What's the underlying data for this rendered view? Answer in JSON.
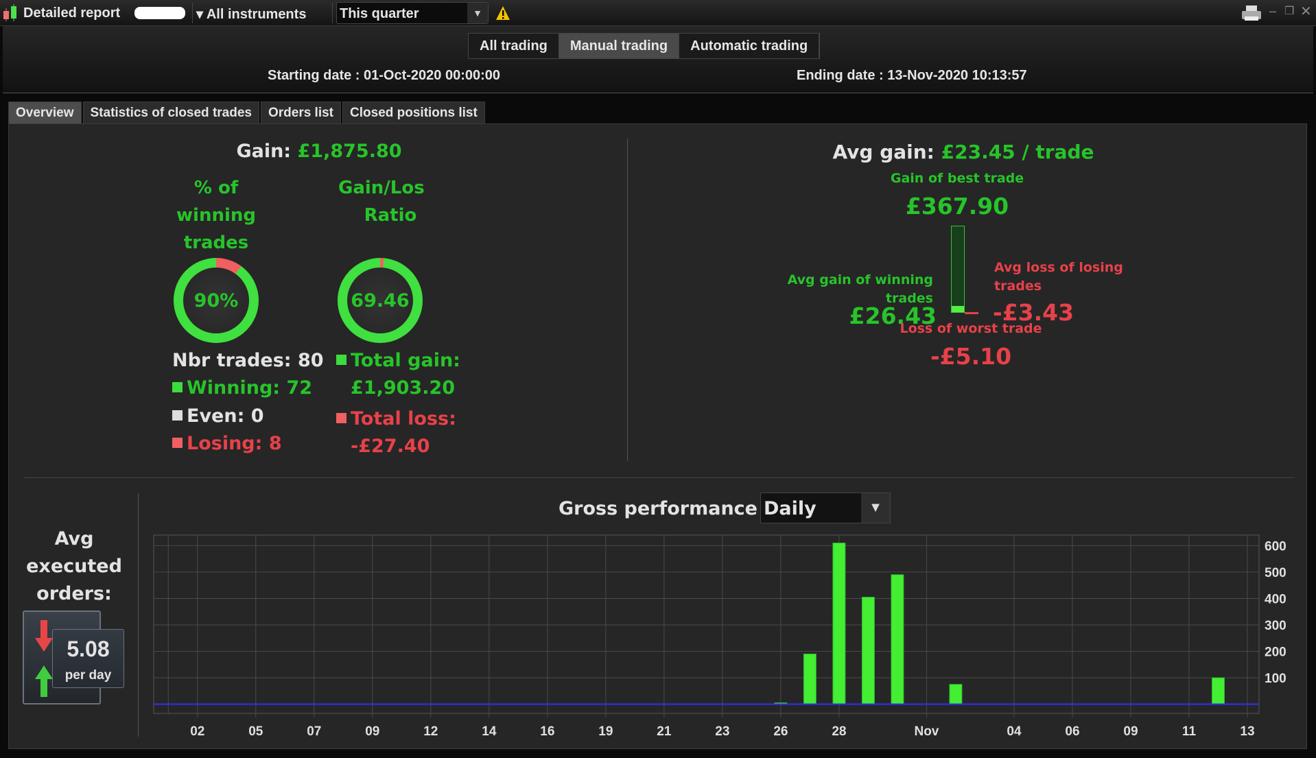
{
  "topbar": {
    "title": "Detailed report",
    "instruments": "All instruments",
    "period": "This quarter",
    "icons": [
      "candlestick-icon",
      "warning-icon",
      "print-icon",
      "minimize-icon",
      "restore-icon",
      "close-icon"
    ]
  },
  "trading_tabs": [
    "All trading",
    "Manual trading",
    "Automatic trading"
  ],
  "dates": {
    "start": "Starting date : 01-Oct-2020 00:00:00",
    "end": "Ending date : 13-Nov-2020 10:13:57"
  },
  "tabs": [
    "Overview",
    "Statistics of closed trades",
    "Orders list",
    "Closed positions list"
  ],
  "overview": {
    "gain_label": "Gain:",
    "gain_value": "£1,875.80",
    "pct_label": [
      "% of",
      "winning",
      "trades"
    ],
    "pct_value": "90%",
    "pct_fraction": 0.9,
    "ratio_label": [
      "Gain/Los",
      "Ratio"
    ],
    "ratio_value": "69.46",
    "ratio_fraction": 0.986,
    "nbr_trades": "Nbr trades: 80",
    "winning": "Winning: 72",
    "even": "Even: 0",
    "losing": "Losing: 8",
    "total_gain_label": "Total gain:",
    "total_gain": "£1,903.20",
    "total_loss_label": "Total loss:",
    "total_loss": "-£27.40",
    "avg_gain_label": "Avg gain:",
    "avg_gain_value": "£23.45 / trade",
    "best_label": "Gain of best trade",
    "best_value": "£367.90",
    "avg_win_label": [
      "Avg gain of winning",
      "trades"
    ],
    "avg_win_value": "£26.43",
    "avg_loss_label": [
      "Avg loss of losing",
      "trades"
    ],
    "avg_loss_value": "-£3.43",
    "worst_label": "Loss of worst trade",
    "worst_value": "-£5.10",
    "orders_label": [
      "Avg",
      "executed",
      "orders:"
    ],
    "orders_value": "5.08",
    "orders_unit": "per day"
  },
  "colors": {
    "green": "#27c42a",
    "red": "#e8414a",
    "bar": "#44ee33",
    "zero_line": "#3030ff"
  },
  "chart_data": {
    "type": "bar",
    "title": "Gross performance",
    "period_select": "Daily",
    "x_ticks": [
      {
        "label": "02",
        "slot": 1
      },
      {
        "label": "05",
        "slot": 3
      },
      {
        "label": "07",
        "slot": 5
      },
      {
        "label": "09",
        "slot": 7
      },
      {
        "label": "12",
        "slot": 9
      },
      {
        "label": "14",
        "slot": 11
      },
      {
        "label": "16",
        "slot": 13
      },
      {
        "label": "19",
        "slot": 15
      },
      {
        "label": "21",
        "slot": 17
      },
      {
        "label": "23",
        "slot": 19
      },
      {
        "label": "26",
        "slot": 21
      },
      {
        "label": "28",
        "slot": 23
      },
      {
        "label": "Nov",
        "slot": 26
      },
      {
        "label": "04",
        "slot": 29
      },
      {
        "label": "06",
        "slot": 31
      },
      {
        "label": "09",
        "slot": 33
      },
      {
        "label": "11",
        "slot": 35
      },
      {
        "label": "13",
        "slot": 37
      }
    ],
    "bars": [
      {
        "date": "26-Oct",
        "slot": 21,
        "value": 5
      },
      {
        "date": "27-Oct",
        "slot": 22,
        "value": 190
      },
      {
        "date": "28-Oct",
        "slot": 23,
        "value": 610
      },
      {
        "date": "29-Oct",
        "slot": 24,
        "value": 405
      },
      {
        "date": "30-Oct",
        "slot": 25,
        "value": 490
      },
      {
        "date": "02-Nov",
        "slot": 27,
        "value": 75
      },
      {
        "date": "12-Nov",
        "slot": 36,
        "value": 100
      }
    ],
    "y_ticks": [
      100,
      200,
      300,
      400,
      500,
      600
    ],
    "xlim": [
      -0.5,
      37.4
    ],
    "ylim": [
      -35,
      640
    ],
    "grid": true
  }
}
